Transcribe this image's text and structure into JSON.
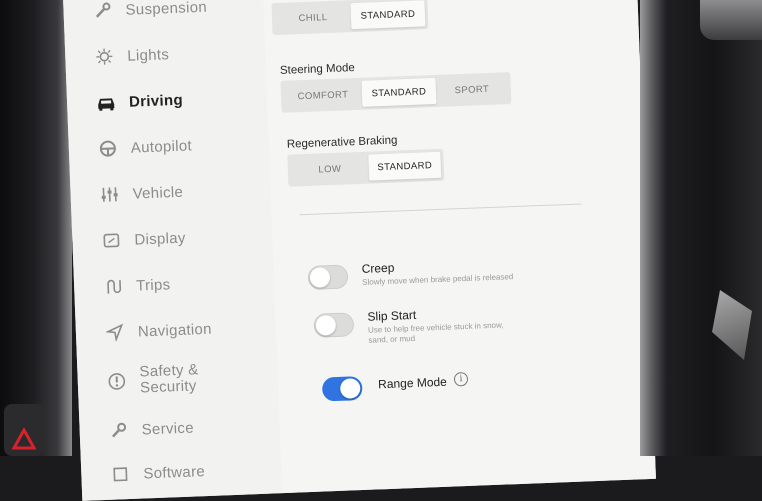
{
  "sidebar": {
    "items": [
      {
        "label": "Suspension",
        "icon": "wrench-icon"
      },
      {
        "label": "Lights",
        "icon": "light-icon"
      },
      {
        "label": "Driving",
        "icon": "car-icon",
        "active": true
      },
      {
        "label": "Autopilot",
        "icon": "steering-wheel-icon"
      },
      {
        "label": "Vehicle",
        "icon": "sliders-icon"
      },
      {
        "label": "Display",
        "icon": "display-icon"
      },
      {
        "label": "Trips",
        "icon": "trips-icon"
      },
      {
        "label": "Navigation",
        "icon": "navigation-arrow-icon"
      },
      {
        "label": "Safety &",
        "label2": "Security",
        "icon": "info-circle-icon"
      },
      {
        "label": "Service",
        "icon": "wrench-service-icon"
      },
      {
        "label": "Software",
        "icon": "software-icon"
      }
    ]
  },
  "acceleration": {
    "options": [
      "CHILL",
      "STANDARD"
    ],
    "selected": "STANDARD"
  },
  "steering_mode": {
    "label": "Steering Mode",
    "options": [
      "COMFORT",
      "STANDARD",
      "SPORT"
    ],
    "selected": "STANDARD"
  },
  "regen_braking": {
    "label": "Regenerative Braking",
    "options": [
      "LOW",
      "STANDARD"
    ],
    "selected": "STANDARD"
  },
  "creep": {
    "title": "Creep",
    "description": "Slowly move when brake pedal is released",
    "enabled": false
  },
  "slip_start": {
    "title": "Slip Start",
    "description_line1": "Use to help free vehicle stuck in snow,",
    "description_line2": "sand, or mud",
    "enabled": false
  },
  "range_mode": {
    "title": "Range Mode",
    "info_glyph": "i",
    "enabled": true
  },
  "colors": {
    "accent": "#2f74e0",
    "screen_bg": "#f5f5f3",
    "hazard": "#d6222a"
  }
}
